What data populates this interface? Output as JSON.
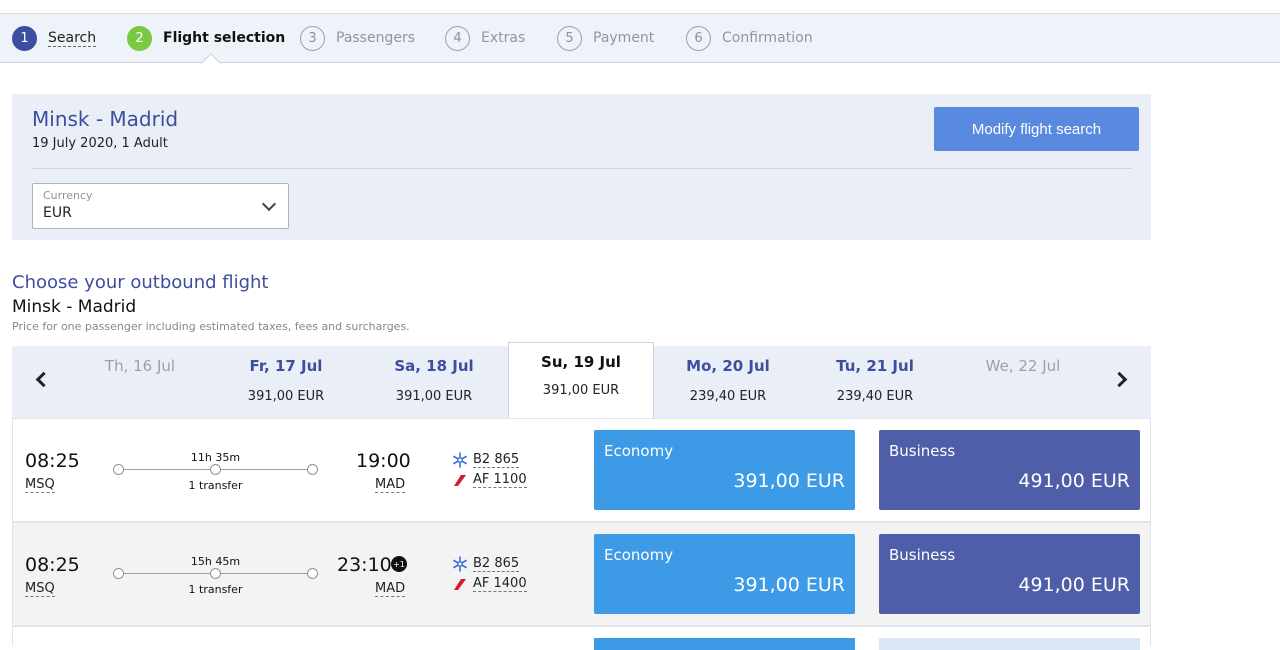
{
  "steps": [
    {
      "num": "1",
      "label": "Search"
    },
    {
      "num": "2",
      "label": "Flight selection"
    },
    {
      "num": "3",
      "label": "Passengers"
    },
    {
      "num": "4",
      "label": "Extras"
    },
    {
      "num": "5",
      "label": "Payment"
    },
    {
      "num": "6",
      "label": "Confirmation"
    }
  ],
  "summary": {
    "route": "Minsk - Madrid",
    "details": "19 July 2020, 1 Adult",
    "modify_label": "Modify flight search",
    "currency_label": "Currency",
    "currency_value": "EUR"
  },
  "heading": {
    "title": "Choose your outbound flight",
    "route": "Minsk - Madrid",
    "note": "Price for one passenger including estimated taxes, fees and surcharges."
  },
  "dates": [
    {
      "label": "Th, 16 Jul",
      "price": ""
    },
    {
      "label": "Fr, 17 Jul",
      "price": "391,00 EUR"
    },
    {
      "label": "Sa, 18 Jul",
      "price": "391,00 EUR"
    },
    {
      "label": "Su, 19 Jul",
      "price": "391,00 EUR"
    },
    {
      "label": "Mo, 20 Jul",
      "price": "239,40 EUR"
    },
    {
      "label": "Tu, 21 Jul",
      "price": "239,40 EUR"
    },
    {
      "label": "We, 22 Jul",
      "price": ""
    }
  ],
  "flights": [
    {
      "dep_time": "08:25",
      "dep_code": "MSQ",
      "duration": "11h 35m",
      "transfers": "1 transfer",
      "arr_time": "19:00",
      "arr_code": "MAD",
      "day_offset": "",
      "segments": [
        {
          "icon": "belavia-snowflake-icon",
          "number": "B2 865"
        },
        {
          "icon": "air-france-stripe-icon",
          "number": "AF 1100"
        }
      ],
      "economy_label": "Economy",
      "economy_price": "391,00 EUR",
      "business_label": "Business",
      "business_price": "491,00 EUR"
    },
    {
      "dep_time": "08:25",
      "dep_code": "MSQ",
      "duration": "15h 45m",
      "transfers": "1 transfer",
      "arr_time": "23:10",
      "arr_code": "MAD",
      "day_offset": "+1",
      "segments": [
        {
          "icon": "belavia-snowflake-icon",
          "number": "B2 865"
        },
        {
          "icon": "air-france-stripe-icon",
          "number": "AF 1400"
        }
      ],
      "economy_label": "Economy",
      "economy_price": "391,00 EUR",
      "business_label": "Business",
      "business_price": "491,00 EUR"
    }
  ],
  "colors": {
    "brand": "#3d4ea0",
    "active_step": "#7ac943",
    "economy": "#3d9ae6",
    "business": "#4f5ea8",
    "modify_button": "#5a8ae0"
  }
}
